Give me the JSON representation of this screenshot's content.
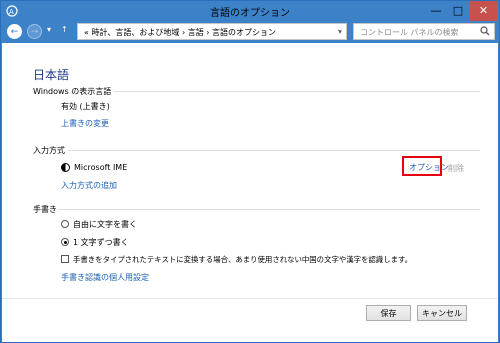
{
  "window": {
    "title": "言語のオプション",
    "minimize_glyph": "—",
    "maximize_glyph": "□",
    "close_glyph": "✕"
  },
  "nav": {
    "back_glyph": "←",
    "forward_glyph": "→",
    "recent_glyph": "▾",
    "up_glyph": "↑",
    "breadcrumb": "« 時計、言語、および地域 › 言語 › 言語のオプション",
    "refresh_glyph": "↻",
    "dropdown_glyph": "▾",
    "search_placeholder": "コントロール パネルの検索"
  },
  "main": {
    "heading": "日本語",
    "windows_display_language": {
      "label": "Windows の表示言語",
      "value": "有効 (上書き)",
      "change_link": "上書きの変更"
    },
    "input_method": {
      "label": "入力方式",
      "ime_name": "Microsoft IME",
      "options_link": "オプション",
      "remove_link": "削除",
      "add_link": "入力方式の追加"
    },
    "handwriting": {
      "label": "手書き",
      "option_freeform": "自由に文字を書く",
      "option_single": "1 文字ずつ書く",
      "selected": "1 文字ずつ書く",
      "checkbox_text": "手書きをタイプされたテキストに変換する場合、あまり使用されない中国の文字や漢字を認識します。",
      "checkbox_checked": false,
      "personalize_link": "手書き認識の個人用設定"
    }
  },
  "footer": {
    "save_label": "保存",
    "cancel_label": "キャンセル"
  },
  "colors": {
    "titlebar": "#3c82c9",
    "close_button": "#c7514d",
    "link": "#1a5fb4",
    "heading": "#1e3a8a",
    "highlight": "#e60012"
  }
}
